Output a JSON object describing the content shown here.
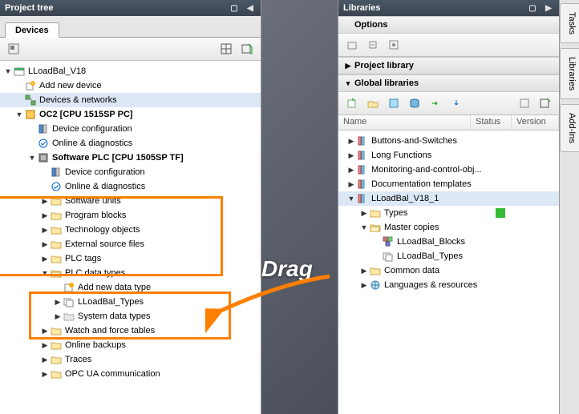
{
  "left": {
    "title": "Project tree",
    "tab": "Devices",
    "root": "LLoadBal_V18",
    "nodes": {
      "add_device": "Add new device",
      "dev_net": "Devices & networks",
      "oc2": "OC2 [CPU 1515SP PC]",
      "dev_cfg": "Device configuration",
      "online": "Online & diagnostics",
      "soft_plc": "Software PLC [CPU 1505SP TF]",
      "dev_cfg2": "Device configuration",
      "online2": "Online & diagnostics",
      "sw_units": "Software units",
      "prog_blocks": "Program blocks",
      "tech_obj": "Technology objects",
      "ext_src": "External source files",
      "plc_tags": "PLC tags",
      "plc_dt": "PLC data types",
      "add_dt": "Add new data type",
      "lloadbal_types": "LLoadBal_Types",
      "sys_dt": "System data types",
      "watch": "Watch and force tables",
      "backups": "Online backups",
      "traces": "Traces",
      "opcua": "OPC UA communication"
    }
  },
  "right": {
    "title": "Libraries",
    "options": "Options",
    "proj_lib": "Project library",
    "glob_lib": "Global libraries",
    "cols": {
      "name": "Name",
      "status": "Status",
      "version": "Version"
    },
    "nodes": {
      "buttons": "Buttons-and-Switches",
      "longfn": "Long Functions",
      "monitor": "Monitoring-and-control-obj...",
      "doctpl": "Documentation templates",
      "lloadbal": "LLoadBal_V18_1",
      "types": "Types",
      "master": "Master copies",
      "blocks": "LLoadBal_Blocks",
      "ltypes": "LLoadBal_Types",
      "common": "Common data",
      "lang": "Languages & resources"
    }
  },
  "side": {
    "tasks": "Tasks",
    "libraries": "Libraries",
    "addins": "Add-Ins"
  },
  "drag": "Drag"
}
